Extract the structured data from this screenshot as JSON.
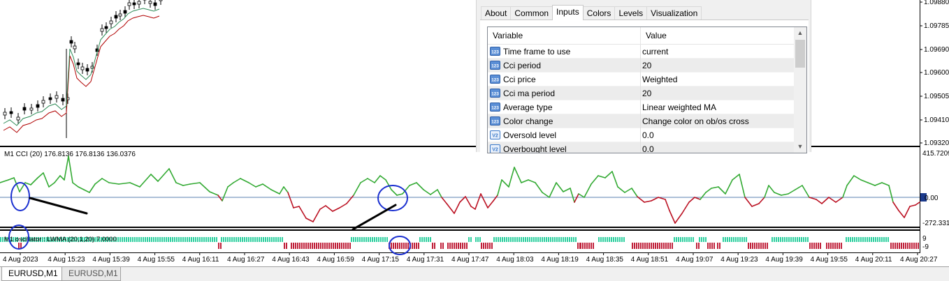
{
  "price_axis": {
    "labels": [
      "1.09880",
      "1.09785",
      "1.09690",
      "1.09600",
      "1.09505",
      "1.09410",
      "1.09320"
    ]
  },
  "cci_window": {
    "label": "M1 CCI (20) 176.8136 176.8136 136.0376",
    "axis_max": "415.7209",
    "axis_zero": "0.00",
    "axis_min": "-272.3311"
  },
  "osc_window": {
    "label": "M1 oscillator : LWMA (20,1,20)  7.0000",
    "axis_top": "9",
    "axis_bottom": "-9"
  },
  "time_axis": {
    "labels": [
      "4 Aug 2023",
      "4 Aug 15:23",
      "4 Aug 15:39",
      "4 Aug 15:55",
      "4 Aug 16:11",
      "4 Aug 16:27",
      "4 Aug 16:43",
      "4 Aug 16:59",
      "4 Aug 17:15",
      "4 Aug 17:31",
      "4 Aug 17:47",
      "4 Aug 18:03",
      "4 Aug 18:19",
      "4 Aug 18:35",
      "4 Aug 18:51",
      "4 Aug 19:07",
      "4 Aug 19:23",
      "4 Aug 19:39",
      "4 Aug 19:55",
      "4 Aug 20:11",
      "4 Aug 20:27"
    ]
  },
  "dialog": {
    "tabs": [
      "About",
      "Common",
      "Inputs",
      "Colors",
      "Levels",
      "Visualization"
    ],
    "active_tab": "Inputs",
    "columns": {
      "variable": "Variable",
      "value": "Value"
    },
    "rows": [
      {
        "icon": "123",
        "variable": "Time frame to use",
        "value": "current"
      },
      {
        "icon": "123",
        "variable": "Cci period",
        "value": "20"
      },
      {
        "icon": "123",
        "variable": "Cci price",
        "value": "Weighted"
      },
      {
        "icon": "123",
        "variable": "Cci ma period",
        "value": "20"
      },
      {
        "icon": "123",
        "variable": "Average type",
        "value": "Linear weighted MA"
      },
      {
        "icon": "123",
        "variable": "Color change",
        "value": "Change color on ob/os cross"
      },
      {
        "icon": "V2",
        "variable": "Oversold level",
        "value": "0.0"
      },
      {
        "icon": "V2",
        "variable": "Overbought level",
        "value": "0.0"
      }
    ]
  },
  "bottom_tabs": [
    "EURUSD,M1",
    "EURUSD,M1"
  ],
  "colors": {
    "cci_up": "#33aa33",
    "cci_down": "#bb1122",
    "hist_up": "#30d0a0",
    "hist_down": "#c0203a",
    "annotation_blue": "#1a2fd0",
    "annotation_black": "#000000",
    "ma_red": "#b00000",
    "ma_green": "#2e8b57",
    "value_icon_blue": "#3a78c8"
  }
}
